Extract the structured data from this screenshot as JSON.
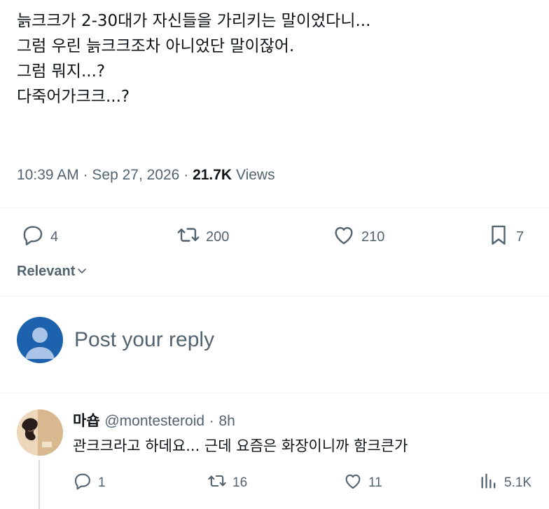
{
  "tweet": {
    "lines": [
      "늙크크가 2-30대가 자신들을 가리키는 말이었다니...",
      "",
      "그럼 우린 늙크크조차 아니었단 말이잖어.",
      "그럼 뭐지...?",
      "다죽어가크크...?"
    ],
    "time": "10:39 AM",
    "separator": "·",
    "date": "Sep 27, 2026",
    "views_count": "21.7K",
    "views_label": "Views"
  },
  "actions": {
    "replies": "4",
    "retweets": "200",
    "likes": "210",
    "bookmarks": "7"
  },
  "sort": {
    "label": "Relevant"
  },
  "composer": {
    "placeholder": "Post your reply"
  },
  "reply": {
    "name": "마숍",
    "handle": "@montesteroid",
    "separator": "·",
    "age": "8h",
    "text": "관크크라고 하데요... 근데 요즘은 화장이니까 함크큰가",
    "replies": "1",
    "retweets": "16",
    "likes": "11",
    "views": "5.1K"
  },
  "icons": {
    "reply": "reply-icon",
    "retweet": "retweet-icon",
    "like": "heart-icon",
    "bookmark": "bookmark-icon",
    "views": "views-chart-icon",
    "chevron": "chevron-down-icon"
  },
  "colors": {
    "text": "#0f1419",
    "secondary": "#536471",
    "divider": "#eff3f4",
    "avatar_default": "#1d62ad"
  }
}
